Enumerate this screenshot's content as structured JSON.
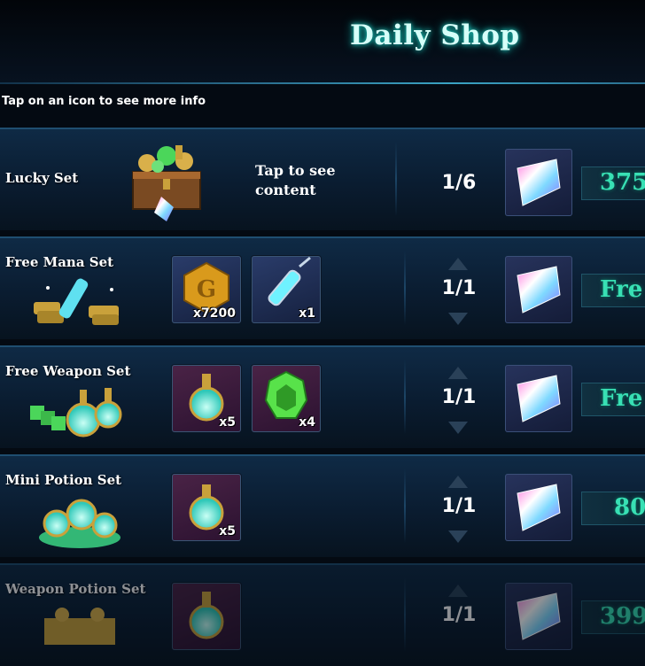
{
  "header": {
    "title": "Daily Shop",
    "hint": "Tap on an icon to see more info"
  },
  "colors": {
    "accent": "#38e0b4",
    "title_glow": "#1fd6c8",
    "row_bg": "#0f2a45"
  },
  "rows": [
    {
      "name": "Lucky Set",
      "tap_text_1": "Tap to see",
      "tap_text_2": "content",
      "stock": "1/6",
      "price": "375",
      "art_icon": "treasure-chest-icon"
    },
    {
      "name": "Free Mana Set",
      "items": [
        {
          "icon": "gold-coin-icon",
          "count": "x7200"
        },
        {
          "icon": "mana-syringe-icon",
          "count": "x1"
        }
      ],
      "stock": "1/1",
      "price": "Fre",
      "art_icon": "mana-syringe-bundle-icon"
    },
    {
      "name": "Free Weapon Set",
      "items": [
        {
          "icon": "weapon-potion-icon",
          "count": "x5"
        },
        {
          "icon": "green-crystal-icon",
          "count": "x4"
        }
      ],
      "stock": "1/1",
      "price": "Fre",
      "art_icon": "weapon-potion-bundle-icon"
    },
    {
      "name": "Mini Potion Set",
      "items": [
        {
          "icon": "mini-potion-icon",
          "count": "x5"
        }
      ],
      "stock": "1/1",
      "price": "80",
      "art_icon": "mini-potion-bundle-icon"
    },
    {
      "name": "Weapon Potion Set",
      "items": [],
      "stock": "1/1",
      "price": "399",
      "art_icon": "weapon-potion-set-icon"
    }
  ]
}
